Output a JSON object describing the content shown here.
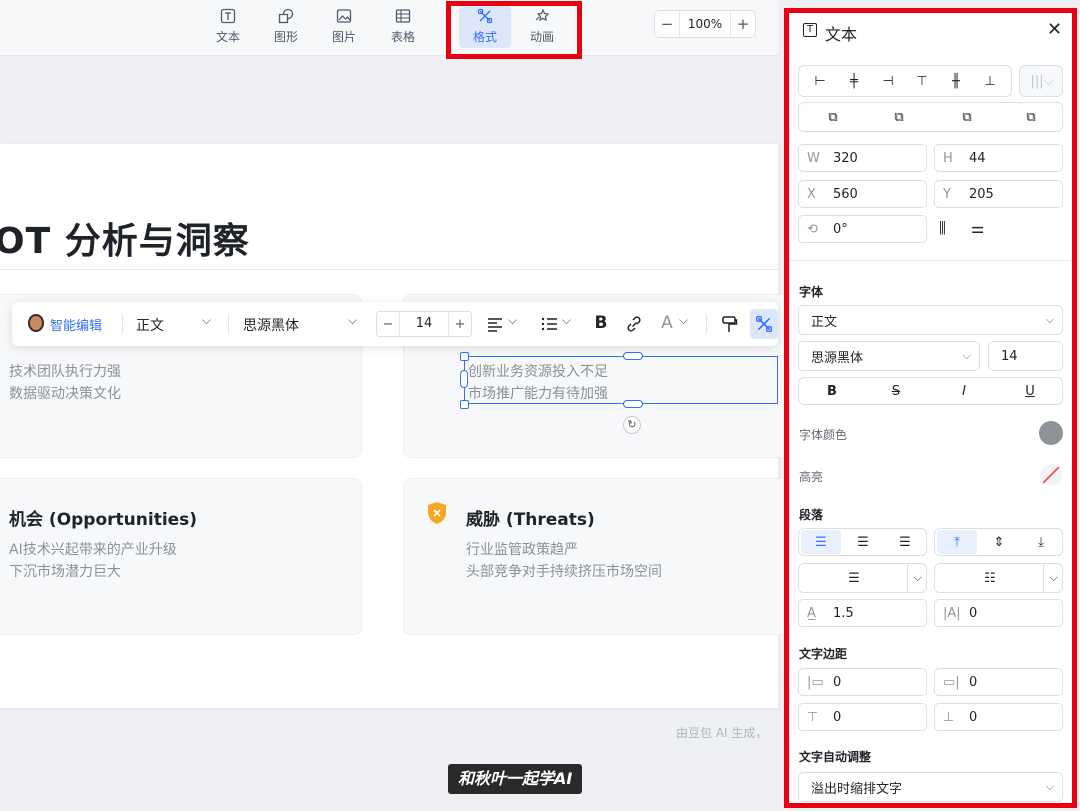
{
  "toolbar": {
    "tools": [
      {
        "label": "文本",
        "icon": "text-icon"
      },
      {
        "label": "图形",
        "icon": "shapes-icon"
      },
      {
        "label": "图片",
        "icon": "image-icon"
      },
      {
        "label": "表格",
        "icon": "table-icon"
      },
      {
        "label": "格式",
        "icon": "format-brush-icon",
        "active": true
      },
      {
        "label": "动画",
        "icon": "animation-icon"
      }
    ],
    "zoom": {
      "minus": "−",
      "value": "100%",
      "plus": "+"
    }
  },
  "slide": {
    "title": "OT 分析与洞察",
    "cards": [
      {
        "heading": "",
        "lines": [
          "技术团队执行力强",
          "数据驱动决策文化"
        ]
      },
      {
        "heading": "",
        "lines": [
          "创新业务资源投入不足",
          "市场推广能力有待加强"
        ]
      },
      {
        "heading": "机会 (Opportunities)",
        "lines": [
          "AI技术兴起带来的产业升级",
          "下沉市场潜力巨大"
        ]
      },
      {
        "heading": "威胁 (Threats)",
        "lines": [
          "行业监管政策趋严",
          "头部竞争对手持续挤压市场空间"
        ],
        "icon_color": "#f5a623"
      }
    ],
    "credit": "由豆包 AI 生成，"
  },
  "float_toolbar": {
    "ai_label": "智能编辑",
    "style_value": "正文",
    "font_value": "思源黑体",
    "size_minus": "−",
    "size_value": "14",
    "size_plus": "+",
    "bold": "B",
    "font_color": "A"
  },
  "watermark": "和秋叶一起学AI",
  "panel": {
    "title": "文本",
    "close": "✕",
    "w_label": "W",
    "w_value": "320",
    "h_label": "H",
    "h_value": "44",
    "x_label": "X",
    "x_value": "560",
    "y_label": "Y",
    "y_value": "205",
    "rotation": "0°",
    "font_section": "字体",
    "style_select": "正文",
    "font_select": "思源黑体",
    "font_size": "14",
    "bold": "B",
    "strike": "S",
    "italic": "I",
    "underline": "U",
    "font_color_label": "字体颜色",
    "font_color": "#8f9296",
    "highlight_label": "高亮",
    "paragraph_section": "段落",
    "line_spacing": "1.5",
    "letter_spacing": "0",
    "margin_section": "文字边距",
    "margin_left": "0",
    "margin_right": "0",
    "margin_top": "0",
    "margin_bottom": "0",
    "autofit_section": "文字自动调整",
    "autofit_value": "溢出时缩排文字"
  },
  "colors": {
    "accent": "#3370ff",
    "annotation_red": "#e60012"
  }
}
